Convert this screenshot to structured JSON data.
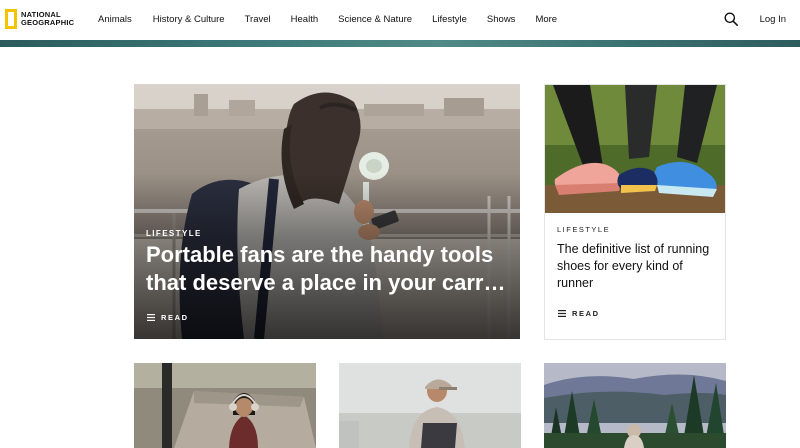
{
  "header": {
    "logo_line1": "NATIONAL",
    "logo_line2": "GEOGRAPHIC",
    "nav": [
      "Animals",
      "History & Culture",
      "Travel",
      "Health",
      "Science & Nature",
      "Lifestyle",
      "Shows",
      "More"
    ],
    "search_icon": "search-icon",
    "login_label": "Log In"
  },
  "hero": {
    "kicker": "LIFESTYLE",
    "title_line1": "Portable fans are the handy tools",
    "title_line2": "that deserve a place in your carr…",
    "read_label": "READ",
    "read_icon": "list-icon"
  },
  "side_card": {
    "kicker": "LIFESTYLE",
    "title": "The definitive list of running shoes for every kind of runner",
    "read_label": "READ",
    "read_icon": "list-icon"
  },
  "colors": {
    "logo_yellow": "#f5c400",
    "band_teal": "#3c7878"
  }
}
